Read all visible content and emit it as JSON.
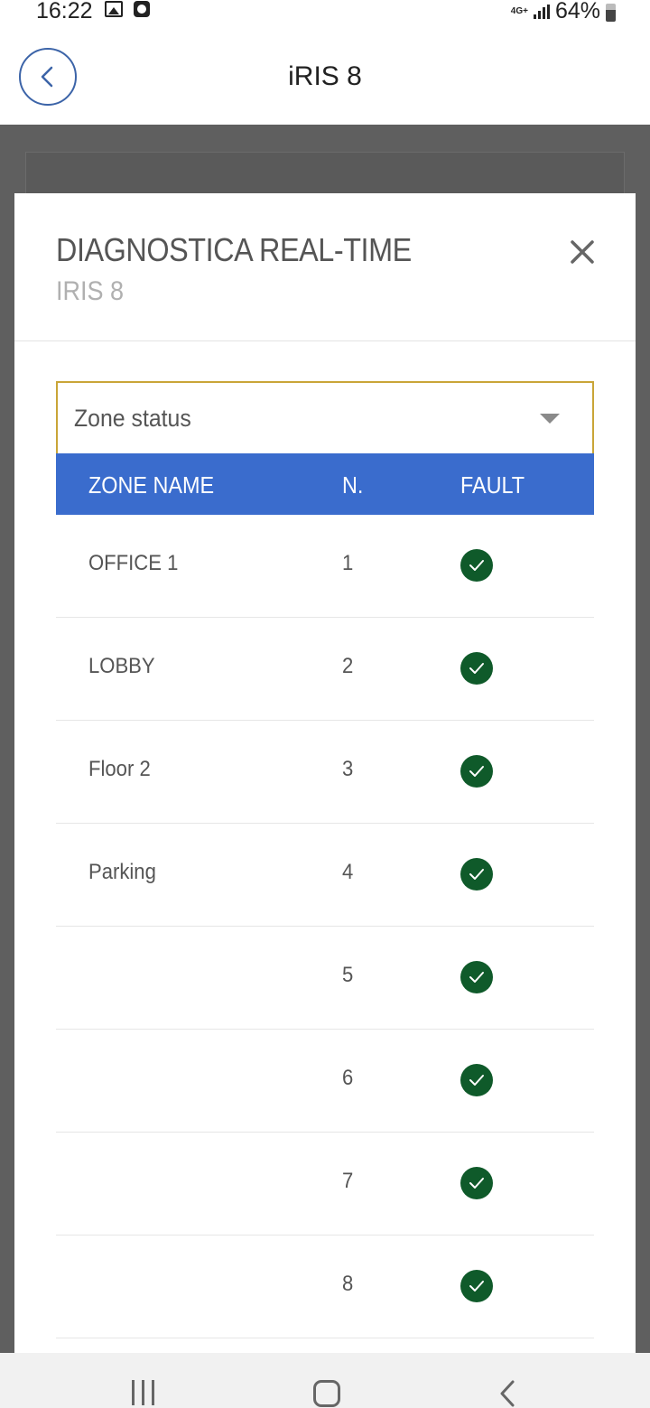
{
  "status_bar": {
    "time": "16:22",
    "network": "4G+",
    "battery": "64%",
    "left_icons": [
      "gallery-icon",
      "clock-app-icon"
    ]
  },
  "header": {
    "title": "iRIS 8",
    "back_icon": "chevron-left-icon",
    "accent_color": "#3c64a8"
  },
  "modal": {
    "title": "DIAGNOSTICA REAL-TIME",
    "subtitle": "IRIS 8",
    "close_icon": "close-icon",
    "select": {
      "value": "Zone status",
      "border_color": "#c9a538"
    },
    "table": {
      "header_color": "#3a6ccd",
      "columns": [
        "ZONE NAME",
        "N.",
        "FAULT"
      ],
      "rows": [
        {
          "name": "OFFICE 1",
          "number": "1",
          "fault": "ok"
        },
        {
          "name": "LOBBY",
          "number": "2",
          "fault": "ok"
        },
        {
          "name": "Floor 2",
          "number": "3",
          "fault": "ok"
        },
        {
          "name": "Parking",
          "number": "4",
          "fault": "ok"
        },
        {
          "name": "",
          "number": "5",
          "fault": "ok"
        },
        {
          "name": "",
          "number": "6",
          "fault": "ok"
        },
        {
          "name": "",
          "number": "7",
          "fault": "ok"
        },
        {
          "name": "",
          "number": "8",
          "fault": "ok"
        }
      ],
      "fault_ok_color": "#0f5a2a"
    }
  },
  "nav_bar": {
    "icons": [
      "recent-apps-icon",
      "home-icon",
      "back-icon"
    ]
  }
}
